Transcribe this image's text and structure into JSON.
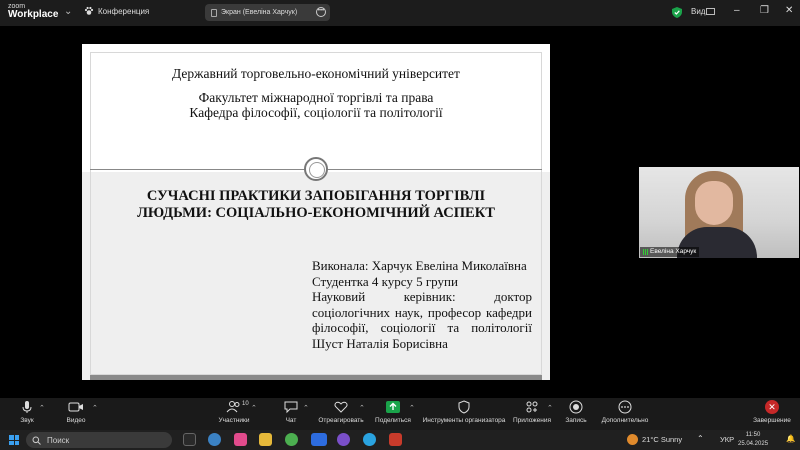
{
  "titlebar": {
    "logo_small": "zoom",
    "logo_big": "Workplace",
    "meeting_label": "Конференция",
    "share_label": "Экран (Евеліна Харчук)",
    "view_label": "Вид"
  },
  "slide": {
    "university": "Державний торговельно-економічний університет",
    "faculty": "Факультет міжнародної торгівлі та права",
    "department": "Кафедра філософії, соціології та політології",
    "topic_line1": "СУЧАСНІ ПРАКТИКИ ЗАПОБІГАННЯ ТОРГІВЛІ",
    "topic_line2": "ЛЮДЬМИ: СОЦІАЛЬНО-ЕКОНОМІЧНИЙ АСПЕКТ",
    "author": "Виконала: Харчук Евеліна Миколаївна",
    "student": "Студентка 4 курсу 5 групи",
    "supervisor_l1": "Науковий керівник: доктор",
    "supervisor_l2": "соціологічних наук, професор кафедри",
    "supervisor_l3": "філософії, соціології та політології",
    "supervisor_l4": "Шуст Наталія Борисівна"
  },
  "video": {
    "participant_name": "Евеліна Харчук"
  },
  "toolbar": {
    "audio": "Звук",
    "video": "Видео",
    "participants": "Участники",
    "participants_count": "10",
    "chat": "Чат",
    "react": "Отреагировать",
    "share": "Поделиться",
    "host_tools": "Инструменты организатора",
    "apps": "Приложения",
    "record": "Запись",
    "more": "Дополнительно",
    "end": "Завершение"
  },
  "taskbar": {
    "search_placeholder": "Поиск",
    "weather": "21°C  Sunny",
    "language": "УКР",
    "time": "11:50",
    "date": "25.04.2025"
  },
  "colors": {
    "share_green": "#1aa34a",
    "end_red": "#c62828",
    "windows_blue": "#3aa0f0"
  }
}
